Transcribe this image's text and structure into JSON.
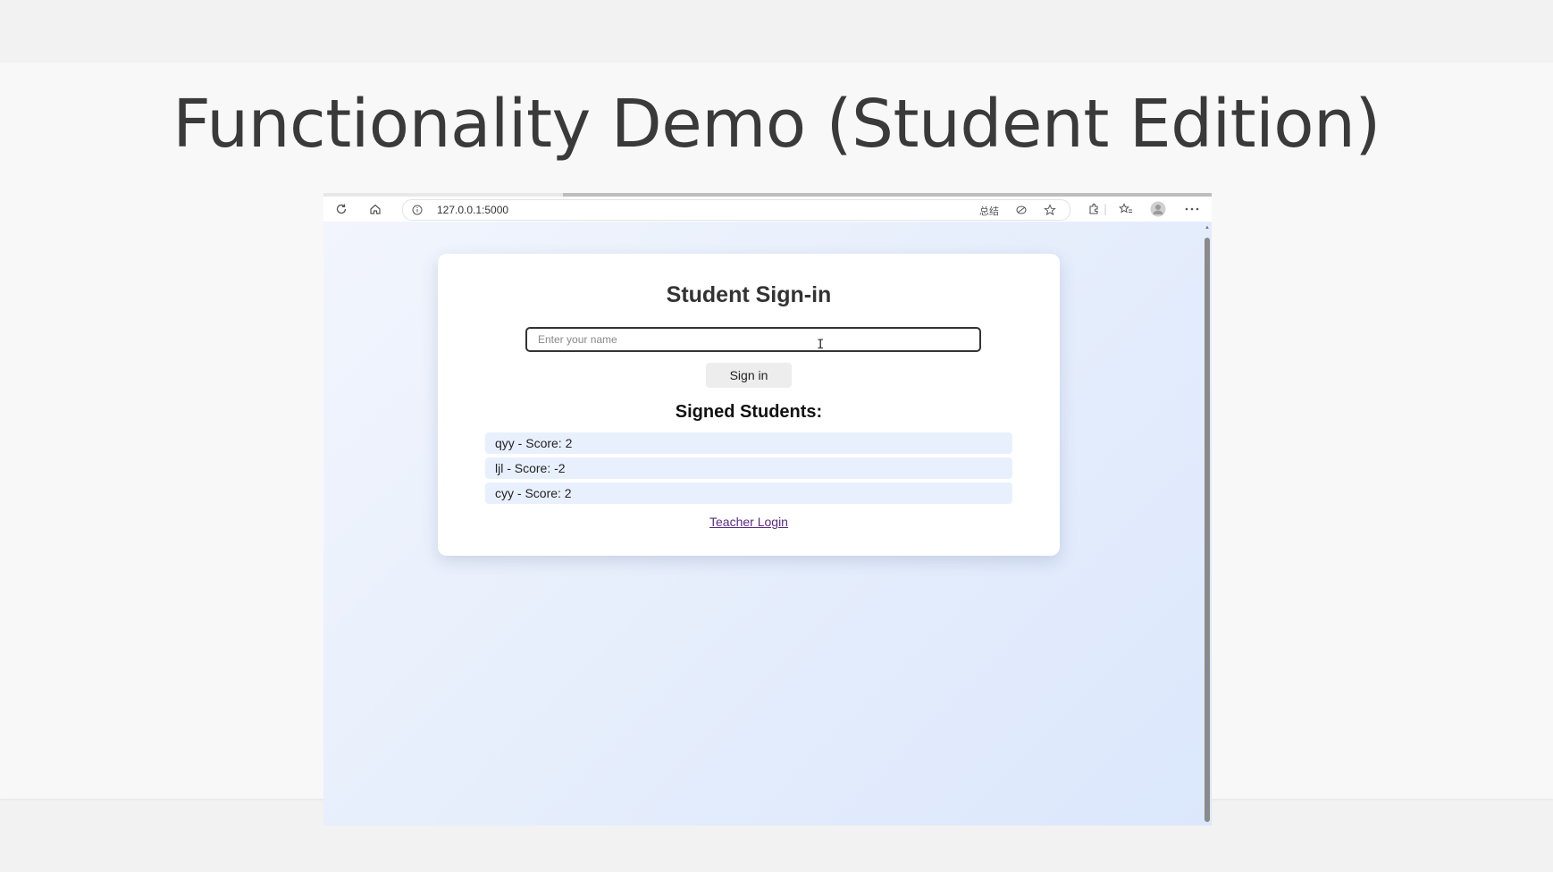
{
  "slide": {
    "title": "Functionality Demo (Student Edition)"
  },
  "browser": {
    "url": "127.0.0.1:5000",
    "summary_label": "总结",
    "icons": {
      "reload": "reload-icon",
      "home": "home-icon",
      "site_info": "info-icon",
      "read_aloud": "read-aloud-icon",
      "favorite": "star-icon",
      "extensions": "extensions-icon",
      "favorites_list": "favorites-icon",
      "profile": "profile-icon",
      "menu": "more-icon"
    }
  },
  "page": {
    "title": "Student Sign-in",
    "name_input": {
      "placeholder": "Enter your name",
      "value": ""
    },
    "signin_label": "Sign in",
    "students_heading": "Signed Students:",
    "students": [
      {
        "text": "qyy - Score: 2"
      },
      {
        "text": "ljl - Score: -2"
      },
      {
        "text": "cyy - Score: 2"
      }
    ],
    "teacher_link_label": "Teacher Login"
  },
  "colors": {
    "background_gradient_start": "#f2f5fd",
    "background_gradient_end": "#dbe7fc",
    "list_item_bg": "#e9f0fd",
    "link": "#5a2a86"
  }
}
